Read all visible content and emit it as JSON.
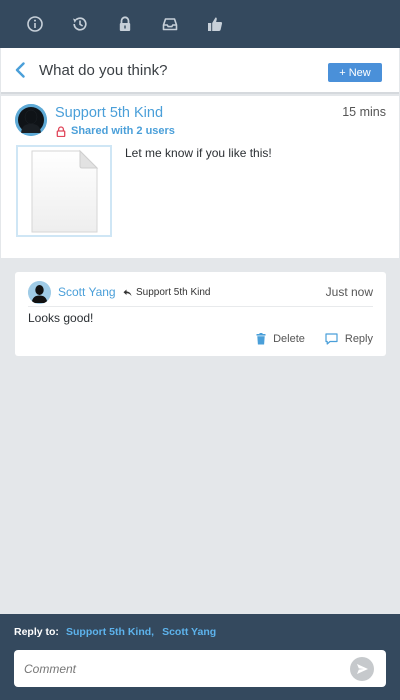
{
  "topbar": {
    "icons": [
      "info-icon",
      "history-icon",
      "lock-icon",
      "inbox-icon",
      "thumbs-up-icon"
    ],
    "icon_color": "#c7d0d9"
  },
  "header": {
    "title": "What do you think?",
    "new_button_label": "+ New",
    "accent": "#4a90d9"
  },
  "post": {
    "author": "Support 5th Kind",
    "time": "15 mins",
    "shared_text": "Shared with 2 users",
    "message": "Let me know if you like this!",
    "lock_color": "#e0465a"
  },
  "comment": {
    "author": "Scott Yang",
    "in_reply_to": "Support 5th Kind",
    "time": "Just now",
    "body": "Looks good!",
    "delete_label": "Delete",
    "reply_label": "Reply"
  },
  "footer": {
    "reply_to_label": "Reply to:",
    "recipients": [
      "Support 5th Kind,",
      "Scott Yang"
    ],
    "comment_placeholder": "Comment"
  }
}
